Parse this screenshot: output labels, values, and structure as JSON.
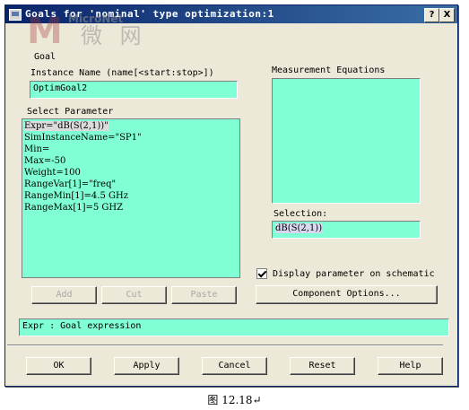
{
  "window": {
    "title": "Goals for 'nominal' type optimization:1",
    "help_button": "?",
    "close_button": "X"
  },
  "watermark": {
    "logo": "M",
    "brand": "MicroNet",
    "chinese": "微 网"
  },
  "goal": {
    "label": "Goal",
    "instance_name_label": "Instance Name   (name[<start:stop>])",
    "instance_name_value": "OptimGoal2"
  },
  "select_parameter": {
    "label": "Select Parameter",
    "items": [
      "Expr=\"dB(S(2,1))\"",
      "SimInstanceName=\"SP1\"",
      "Min=",
      "Max=-50",
      "Weight=100",
      "RangeVar[1]=\"freq\"",
      "RangeMin[1]=4.5 GHz",
      "RangeMax[1]=5 GHZ"
    ]
  },
  "measurement": {
    "label": "Measurement Equations",
    "selection_label": "Selection:",
    "selection_value": "dB(S(2,1))"
  },
  "display_checkbox": {
    "label": "Display parameter on schematic",
    "checked": true
  },
  "buttons": {
    "add": "Add",
    "cut": "Cut",
    "paste": "Paste",
    "component_options": "Component Options...",
    "ok": "OK",
    "apply": "Apply",
    "cancel": "Cancel",
    "reset": "Reset",
    "help": "Help"
  },
  "status": "Expr : Goal expression",
  "caption": "图 12.18↵",
  "colors": {
    "field_bg": "#80ffd4",
    "dialog_bg": "#ece9d8",
    "title_bar": "#0a246a"
  }
}
